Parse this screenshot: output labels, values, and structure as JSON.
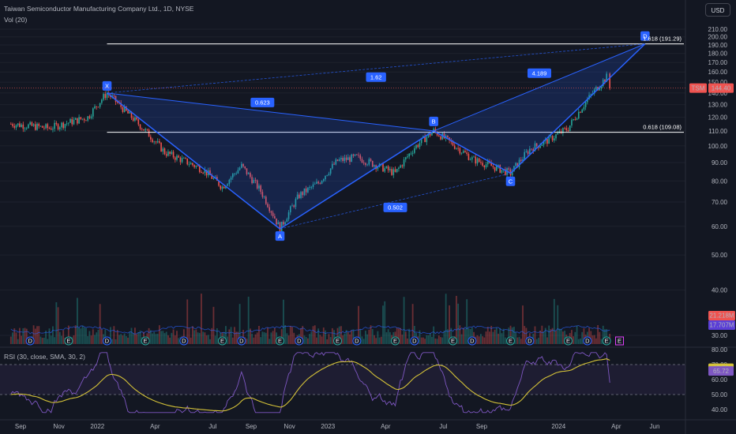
{
  "header": {
    "title": "Taiwan Semiconductor Manufacturing Company Ltd., 1D, NYSE",
    "volume_label": "Vol (20)",
    "currency": "USD",
    "rsi_label": "RSI (30, close, SMA, 30, 2)"
  },
  "chart_data": {
    "type": "line",
    "symbol": "TSM",
    "last_price": "144.40",
    "price_axis": {
      "ticks": [
        "210.00",
        "200.00",
        "190.00",
        "180.00",
        "170.00",
        "160.00",
        "150.00",
        "140.00",
        "130.00",
        "120.00",
        "110.00",
        "100.00",
        "90.00",
        "80.00",
        "70.00",
        "60.00",
        "50.00",
        "40.00",
        "30.00"
      ],
      "range": [
        25,
        215
      ],
      "scale": "log"
    },
    "rsi_axis": {
      "ticks": [
        "80.00",
        "70.00",
        "60.00",
        "50.00",
        "40.00"
      ],
      "range": [
        35,
        85
      ],
      "bands": [
        70,
        50
      ]
    },
    "time_axis": [
      "Sep",
      "Nov",
      "2022",
      "Apr",
      "Jul",
      "Sep",
      "Nov",
      "2023",
      "Apr",
      "Jul",
      "Sep",
      "2024",
      "Apr",
      "Jun"
    ],
    "pattern": {
      "points": [
        {
          "label": "X",
          "date": "2022-01",
          "price": 140
        },
        {
          "label": "A",
          "date": "2022-10",
          "price": 59
        },
        {
          "label": "B",
          "date": "2023-06",
          "price": 110
        },
        {
          "label": "C",
          "date": "2023-10",
          "price": 84
        },
        {
          "label": "D",
          "date": "2024-05",
          "price": 191.29
        }
      ],
      "ratios": [
        "0.623",
        "0.502",
        "4.189",
        "1.62"
      ]
    },
    "fib_levels": [
      {
        "label": "1.618 (191.29)",
        "price": 191.29
      },
      {
        "label": "0.618 (109.08)",
        "price": 109.08
      }
    ],
    "volume_labels": [
      "21.218M",
      "17.707M"
    ],
    "rsi_labels": [
      "67.58",
      "65.72"
    ],
    "event_badges": [
      "D",
      "E"
    ],
    "price_series": [
      {
        "date": "2021-08",
        "close": 115
      },
      {
        "date": "2021-10",
        "close": 112
      },
      {
        "date": "2021-12",
        "close": 120
      },
      {
        "date": "2022-01",
        "close": 140
      },
      {
        "date": "2022-02",
        "close": 124
      },
      {
        "date": "2022-04",
        "close": 96
      },
      {
        "date": "2022-06",
        "close": 86
      },
      {
        "date": "2022-07",
        "close": 77
      },
      {
        "date": "2022-08",
        "close": 88
      },
      {
        "date": "2022-09",
        "close": 75
      },
      {
        "date": "2022-10",
        "close": 59
      },
      {
        "date": "2022-11",
        "close": 73
      },
      {
        "date": "2022-12",
        "close": 79
      },
      {
        "date": "2023-01",
        "close": 91
      },
      {
        "date": "2023-02",
        "close": 93
      },
      {
        "date": "2023-04",
        "close": 84
      },
      {
        "date": "2023-05",
        "close": 99
      },
      {
        "date": "2023-06",
        "close": 110
      },
      {
        "date": "2023-07",
        "close": 101
      },
      {
        "date": "2023-08",
        "close": 92
      },
      {
        "date": "2023-10",
        "close": 84
      },
      {
        "date": "2023-11",
        "close": 98
      },
      {
        "date": "2023-12",
        "close": 104
      },
      {
        "date": "2024-01",
        "close": 112
      },
      {
        "date": "2024-02",
        "close": 134
      },
      {
        "date": "2024-03",
        "close": 155
      },
      {
        "date": "2024-03",
        "close": 144.4
      }
    ]
  },
  "colors": {
    "background": "#131722",
    "pattern": "#2962ff",
    "up": "#26a69a",
    "down": "#ef5350",
    "rsi": "#7e57c2",
    "rsi_sma": "#d4c238"
  }
}
